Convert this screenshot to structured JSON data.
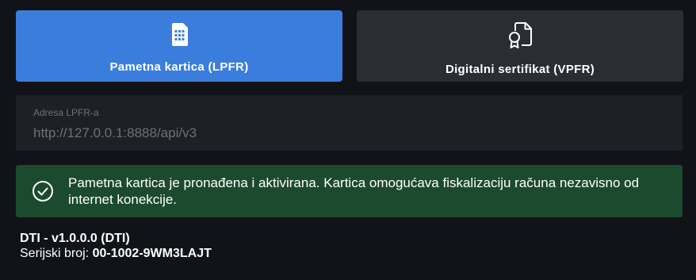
{
  "mode_selector": {
    "smart_card": {
      "label": "Pametna kartica (LPFR)",
      "icon": "sim-card-icon",
      "active": true
    },
    "digital_cert": {
      "label": "Digitalni sertifikat (VPFR)",
      "icon": "certificate-icon",
      "active": false
    }
  },
  "address": {
    "label": "Adresa LPFR-a",
    "value": "http://127.0.0.1:8888/api/v3"
  },
  "status_alert": {
    "icon": "check-circle-icon",
    "message": "Pametna kartica je pronađena i aktivirana. Kartica omogućava fiskalizaciju računa nezavisno od internet konekcije."
  },
  "device": {
    "title": "DTI - v1.0.0.0 (DTI)",
    "serial_label": "Serijski broj:",
    "serial_value": "00-1002-9WM3LAJT"
  },
  "colors": {
    "background": "#111319",
    "active_button": "#3b7ddd",
    "inactive_button": "#2a2d33",
    "input_background": "#1e2026",
    "success_background": "#1c4a2e"
  }
}
